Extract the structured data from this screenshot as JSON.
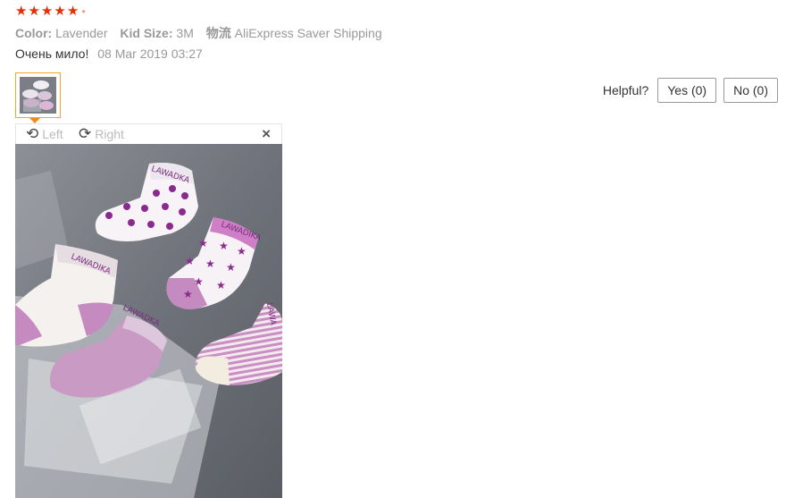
{
  "rating": {
    "stars": 5,
    "icon": "star-icon",
    "color": "#e62e04"
  },
  "attributes": [
    {
      "key": "Color:",
      "value": "Lavender"
    },
    {
      "key": "Kid Size:",
      "value": "3M"
    },
    {
      "key": "物流",
      "value": "AliExpress Saver Shipping"
    }
  ],
  "review": {
    "text": "Очень мило!",
    "date": "08 Mar 2019 03:27"
  },
  "helpful": {
    "label": "Helpful?",
    "yes": "Yes (0)",
    "no": "No (0)"
  },
  "viewer": {
    "left_label": "Left",
    "right_label": "Right",
    "close_icon": "close-icon"
  },
  "photo": {
    "subject": "five baby socks on grey surface",
    "sock_text": [
      "LAWADKA",
      "LAWADIKA",
      "LAWADIKA",
      "LAWADKA",
      "LAWA"
    ]
  },
  "colors": {
    "accent": "#f28a1b",
    "star": "#e62e04",
    "sock_purple": "#8a2a8f",
    "sock_pink": "#c58ac0"
  }
}
